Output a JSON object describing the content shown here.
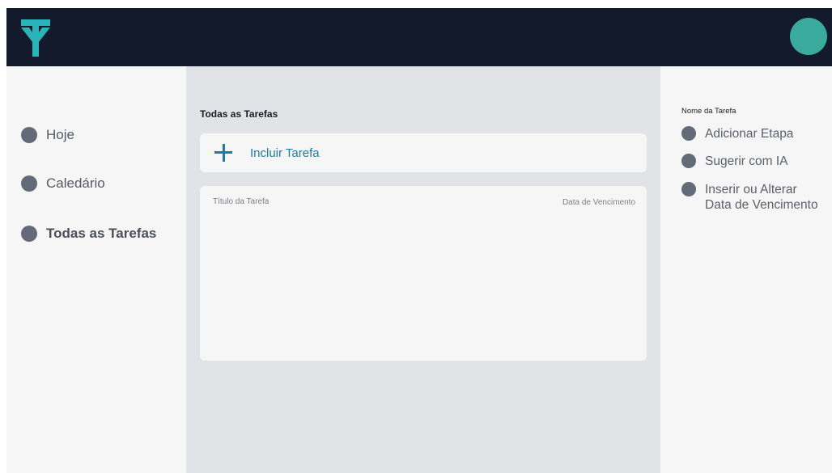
{
  "nav": {
    "items": [
      {
        "label": "Hoje"
      },
      {
        "label": "Caledário"
      },
      {
        "label": "Todas as Tarefas"
      }
    ]
  },
  "main": {
    "title": "Todas as Tarefas",
    "add_task_label": "Incluir Tarefa",
    "columns": {
      "title": "Título da Tarefa",
      "due_date": "Data de Vencimento"
    }
  },
  "detail": {
    "task_name": "Nome da Tarefa",
    "actions": [
      {
        "label": "Adicionar Etapa"
      },
      {
        "label": "Sugerir com IA"
      },
      {
        "label": "Inserir ou Alterar\nData de Vencimento"
      }
    ]
  },
  "colors": {
    "topbar": "#131a2b",
    "accent": "#1f7aa6",
    "avatar": "#3aaa9f",
    "logo": "#2ab3b8"
  },
  "icons": {
    "logo": "ty-logo-icon",
    "add": "plus-icon",
    "bullet": "circle-icon"
  }
}
